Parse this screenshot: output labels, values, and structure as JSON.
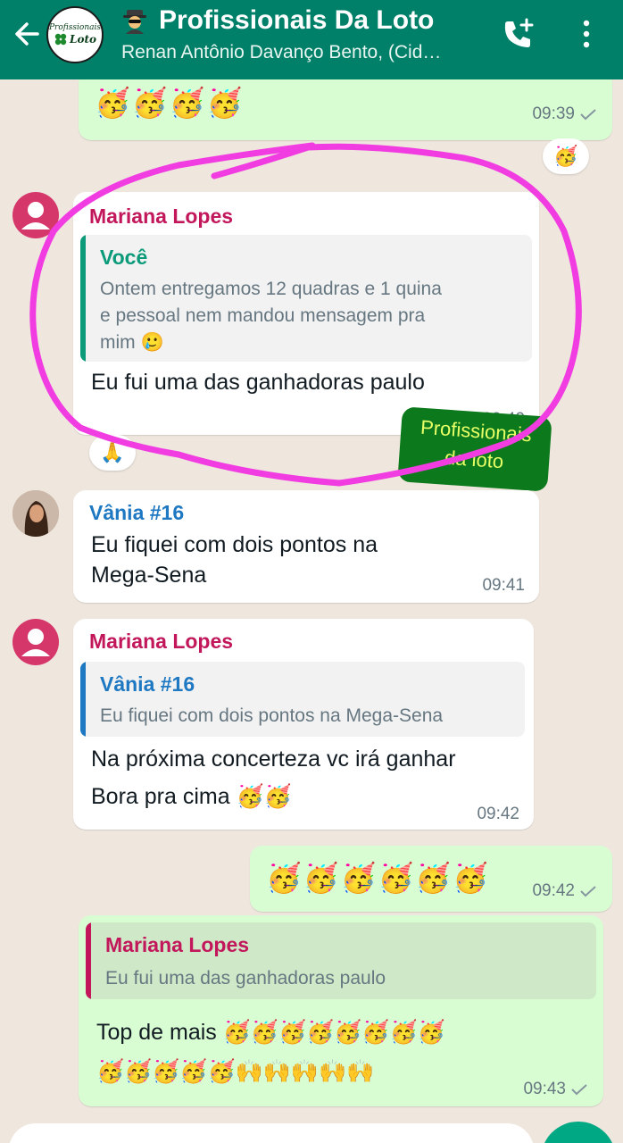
{
  "header": {
    "title": "Profissionais Da Loto",
    "subtitle": "Renan Antônio Davanço Bento, (Cid…",
    "logo_small": "Profissionais",
    "logo_big": "Loto",
    "back_icon": "arrow-left-icon",
    "call_icon": "add-call-icon",
    "menu_icon": "more-vertical-icon",
    "title_emoji": "detective-icon"
  },
  "messages": [
    {
      "id": "m1",
      "direction": "out",
      "text": "🥳🥳🥳🥳",
      "time": "09:39",
      "reaction": "🥳"
    },
    {
      "id": "m2",
      "direction": "in",
      "sender": "Mariana Lopes",
      "quote": {
        "name": "Você",
        "text_lines": [
          "Ontem entregamos 12 quadras e 1 quina",
          "e pessoal nem mandou mensagem pra",
          "mim 🥲"
        ]
      },
      "text": "Eu fui uma das ganhadoras paulo",
      "time": "09:40",
      "reaction": "🙏"
    },
    {
      "id": "m3",
      "direction": "in",
      "sender": "Vânia #16",
      "text_lines": [
        "Eu fiquei com dois pontos na",
        "Mega-Sena"
      ],
      "time": "09:41"
    },
    {
      "id": "m4",
      "direction": "in",
      "sender": "Mariana Lopes",
      "quote": {
        "name": "Vânia #16",
        "text_lines": [
          "Eu fiquei com dois pontos na Mega-Sena"
        ]
      },
      "text_lines": [
        "Na próxima concerteza vc irá ganhar",
        "Bora pra cima 🥳🥳"
      ],
      "time": "09:42"
    },
    {
      "id": "m5",
      "direction": "out",
      "text": "🥳🥳🥳🥳🥳🥳",
      "time": "09:42"
    },
    {
      "id": "m6",
      "direction": "out",
      "quote": {
        "name": "Mariana Lopes",
        "text_lines": [
          "Eu fui uma das ganhadoras paulo"
        ]
      },
      "text_lines": [
        "Top de mais 🥳🥳🥳🥳🥳🥳🥳🥳",
        "🥳🥳🥳🥳🥳🙌🙌🙌🙌🙌"
      ],
      "time": "09:43"
    }
  ],
  "sticker": {
    "line1": "Profissionais",
    "line2": "da loto"
  },
  "colors": {
    "header": "#008069",
    "mariana": "#c2185b",
    "vania": "#1e78c2",
    "voce": "#0b9b7a",
    "annotation": "#f03ce0"
  }
}
